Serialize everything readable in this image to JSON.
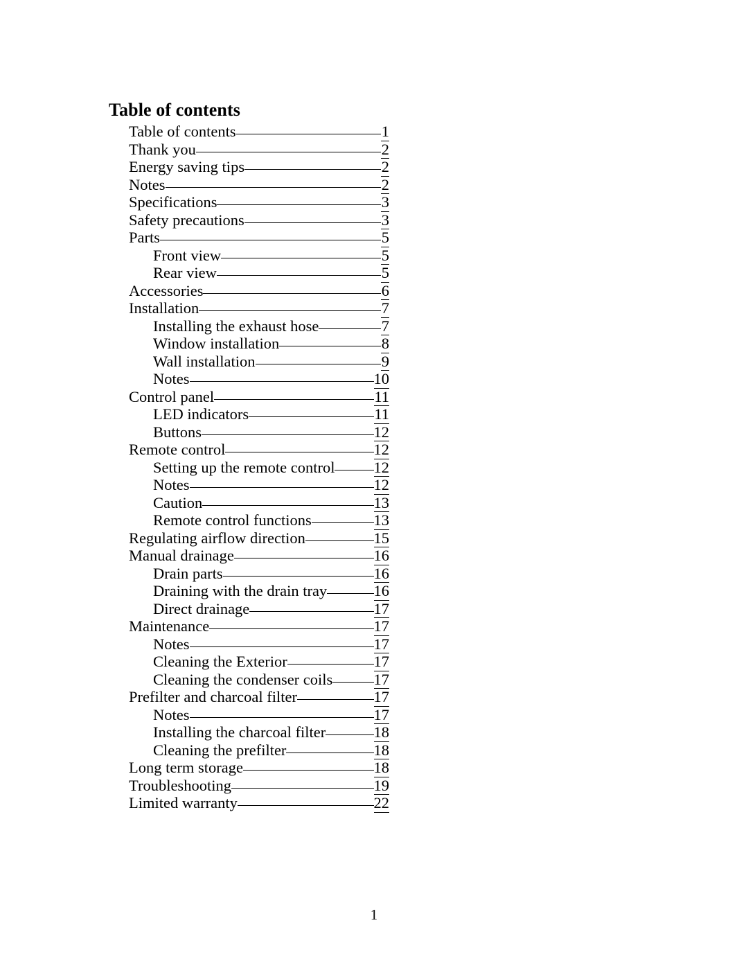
{
  "document": {
    "title": "Table of contents",
    "footer_page_number": "1"
  },
  "toc": {
    "entries": [
      {
        "label": "Table of contents",
        "page": "1",
        "level": 1
      },
      {
        "label": "Thank you",
        "page": "2",
        "level": 1
      },
      {
        "label": "Energy saving tips",
        "page": "2",
        "level": 1
      },
      {
        "label": "Notes",
        "page": "2",
        "level": 1
      },
      {
        "label": "Specifications",
        "page": "3",
        "level": 1
      },
      {
        "label": "Safety precautions",
        "page": "3",
        "level": 1
      },
      {
        "label": "Parts",
        "page": "5",
        "level": 1
      },
      {
        "label": "Front view",
        "page": "5",
        "level": 2
      },
      {
        "label": "Rear view",
        "page": "5",
        "level": 2
      },
      {
        "label": "Accessories",
        "page": "6",
        "level": 1
      },
      {
        "label": "Installation",
        "page": "7",
        "level": 1
      },
      {
        "label": "Installing the exhaust hose",
        "page": "7",
        "level": 2
      },
      {
        "label": "Window installation",
        "page": "8",
        "level": 2
      },
      {
        "label": "Wall installation",
        "page": "9",
        "level": 2
      },
      {
        "label": "Notes",
        "page": "10",
        "level": 2
      },
      {
        "label": "Control panel",
        "page": "11",
        "level": 1
      },
      {
        "label": "LED indicators",
        "page": "11",
        "level": 2
      },
      {
        "label": "Buttons",
        "page": "12",
        "level": 2
      },
      {
        "label": "Remote control",
        "page": "12",
        "level": 1
      },
      {
        "label": "Setting up the remote control",
        "page": "12",
        "level": 2
      },
      {
        "label": "Notes",
        "page": "12",
        "level": 2
      },
      {
        "label": "Caution",
        "page": "13",
        "level": 2
      },
      {
        "label": "Remote control functions",
        "page": "13",
        "level": 2
      },
      {
        "label": "Regulating airflow direction",
        "page": "15",
        "level": 1
      },
      {
        "label": "Manual drainage",
        "page": "16",
        "level": 1
      },
      {
        "label": "Drain parts",
        "page": "16",
        "level": 2
      },
      {
        "label": "Draining with the drain tray",
        "page": "16",
        "level": 2
      },
      {
        "label": "Direct drainage",
        "page": "17",
        "level": 2
      },
      {
        "label": "Maintenance",
        "page": "17",
        "level": 1
      },
      {
        "label": "Notes",
        "page": "17",
        "level": 2
      },
      {
        "label": "Cleaning the Exterior",
        "page": "17",
        "level": 2
      },
      {
        "label": "Cleaning the condenser coils",
        "page": "17",
        "level": 2
      },
      {
        "label": "Prefilter and charcoal filter",
        "page": "17",
        "level": 1
      },
      {
        "label": "Notes",
        "page": "17",
        "level": 2
      },
      {
        "label": "Installing the charcoal filter",
        "page": "18",
        "level": 2
      },
      {
        "label": "Cleaning the prefilter",
        "page": "18",
        "level": 2
      },
      {
        "label": "Long term storage",
        "page": "18",
        "level": 1
      },
      {
        "label": "Troubleshooting",
        "page": "19",
        "level": 1
      },
      {
        "label": "Limited warranty",
        "page": "22",
        "level": 1
      }
    ]
  }
}
